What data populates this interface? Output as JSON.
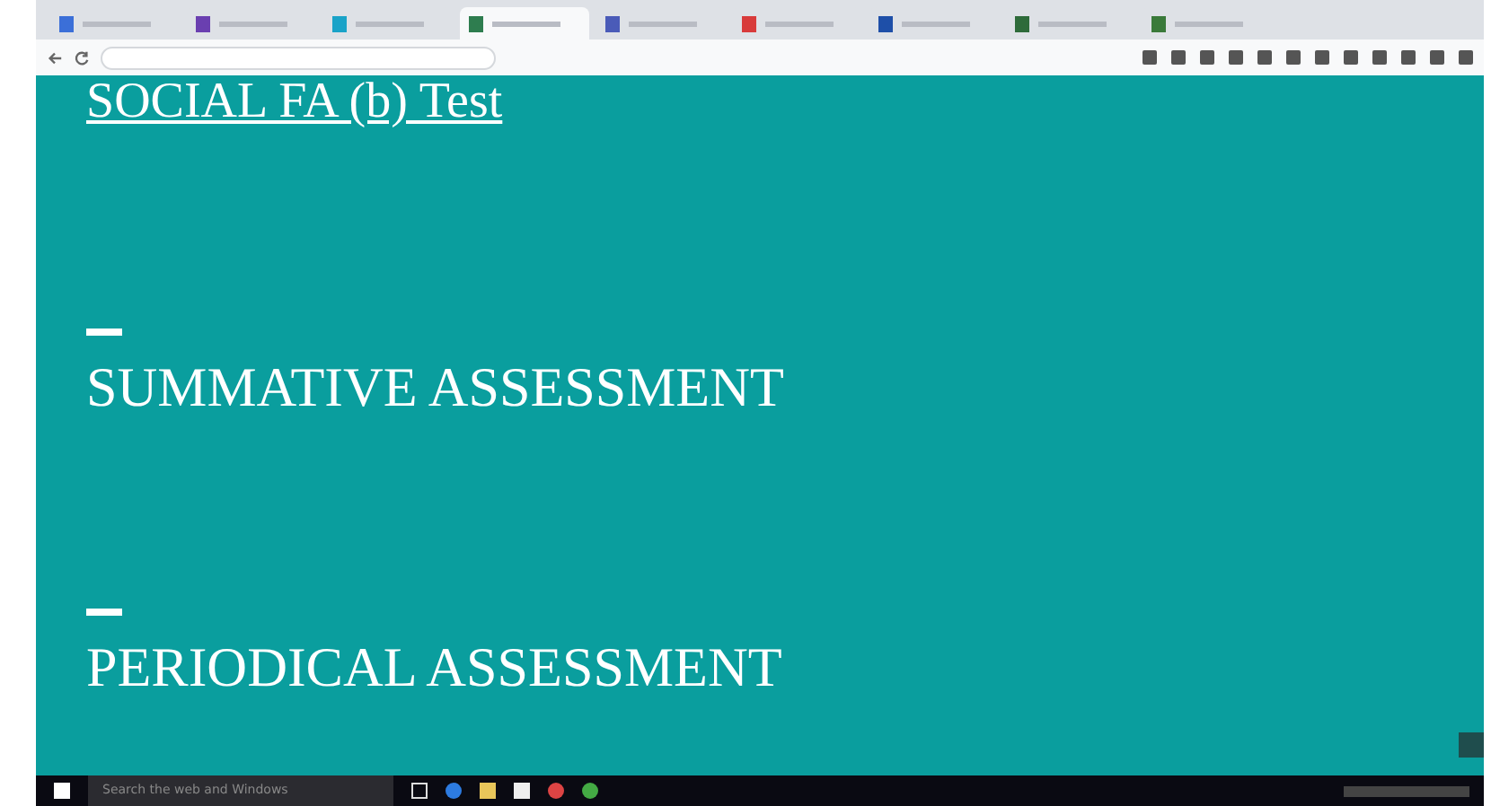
{
  "tabs": [
    {
      "selected": false,
      "color": "#3b6fd8"
    },
    {
      "selected": false,
      "color": "#6a3fb0"
    },
    {
      "selected": false,
      "color": "#1aa3c8"
    },
    {
      "selected": true,
      "color": "#2e7d4f"
    },
    {
      "selected": false,
      "color": "#4a5bb8"
    },
    {
      "selected": false,
      "color": "#d83b3b"
    },
    {
      "selected": false,
      "color": "#1e4fa8"
    },
    {
      "selected": false,
      "color": "#2e6b3a"
    },
    {
      "selected": false,
      "color": "#3a7a3a"
    }
  ],
  "slide": {
    "title": "SOCIAL FA (b) Test",
    "sections": [
      "SUMMATIVE ASSESSMENT",
      "PERIODICAL ASSESSMENT"
    ]
  },
  "taskbar": {
    "search_placeholder": "Search the web and Windows"
  }
}
